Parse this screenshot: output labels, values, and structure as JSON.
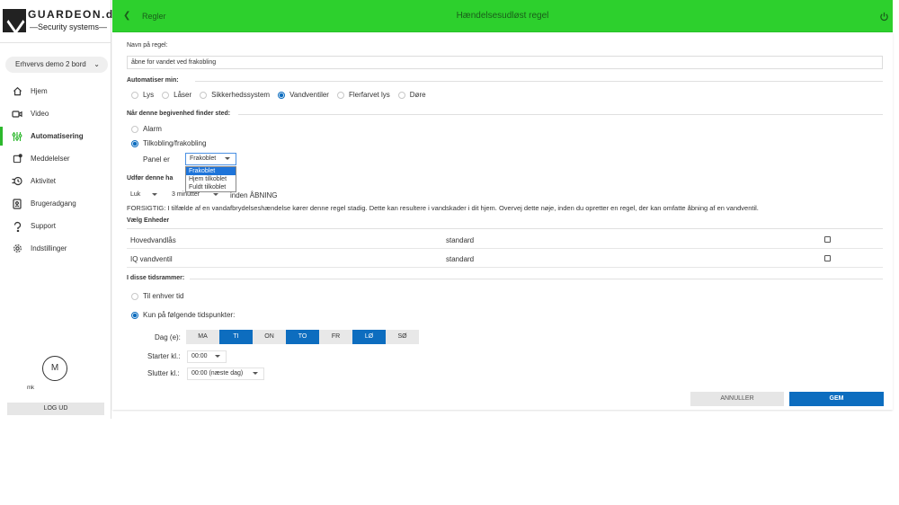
{
  "app": {
    "brand": "GUARDEON.dk",
    "tagline": "—Security systems—"
  },
  "sidebar": {
    "account": "Erhvervs demo 2 bord",
    "items": [
      {
        "label": "Hjem",
        "icon": "home-icon"
      },
      {
        "label": "Video",
        "icon": "video-icon"
      },
      {
        "label": "Automatisering",
        "icon": "automation-icon"
      },
      {
        "label": "Meddelelser",
        "icon": "notifications-icon"
      },
      {
        "label": "Aktivitet",
        "icon": "activity-icon"
      },
      {
        "label": "Brugeradgang",
        "icon": "user-access-icon"
      },
      {
        "label": "Support",
        "icon": "support-icon"
      },
      {
        "label": "Indstillinger",
        "icon": "settings-icon"
      }
    ],
    "active_item": "Automatisering",
    "avatar_initial": "M",
    "user_name": "mk",
    "logout_label": "LOG UD"
  },
  "header": {
    "back_label": "Regler",
    "title": "Hændelsesudløst regel"
  },
  "form": {
    "name_label": "Navn på regel:",
    "name_value": "åbne for vandet ved frakobling",
    "automate_label": "Automatiser min:",
    "automate_options": [
      "Lys",
      "Låser",
      "Sikkerhedssystem",
      "Vandventiler",
      "Flerfarvet lys",
      "Døre"
    ],
    "automate_selected": "Vandventiler",
    "event_label": "Når denne begivenhed finder sted:",
    "event_options": [
      "Alarm",
      "Tilkobling/frakobling"
    ],
    "event_selected": "Tilkobling/frakobling",
    "panel_label": "Panel er",
    "panel_value": "Frakoblet",
    "panel_options": [
      "Frakoblet",
      "Hjem tilkoblet",
      "Fuldt tilkoblet"
    ],
    "action_label": "Udfør denne ha",
    "action_value": "Luk",
    "delay_value": "3 minutter",
    "delay_suffix": "inden ÅBNING",
    "warning": "FORSIGTIG: I tilfælde af en vandafbrydelseshændelse kører denne regel stadig. Dette kan resultere i vandskader i dit hjem. Overvej dette nøje, inden du opretter en regel, der kan omfatte åbning af en vandventil.",
    "devices_label": "Vælg Enheder",
    "devices": [
      {
        "name": "Hovedvandlås",
        "value": "standard",
        "checked": false
      },
      {
        "name": "IQ vandventil",
        "value": "standard",
        "checked": false
      }
    ],
    "time_label": "I disse tidsrammer:",
    "time_options": [
      "Til enhver tid",
      "Kun på følgende tidspunkter:"
    ],
    "time_selected": "Kun på følgende tidspunkter:",
    "days_label": "Dag (e):",
    "days": [
      {
        "label": "MA",
        "on": false
      },
      {
        "label": "TI",
        "on": true
      },
      {
        "label": "ON",
        "on": false
      },
      {
        "label": "TO",
        "on": true
      },
      {
        "label": "FR",
        "on": false
      },
      {
        "label": "LØ",
        "on": true
      },
      {
        "label": "SØ",
        "on": false
      }
    ],
    "start_label": "Starter kl.:",
    "start_value": "00:00",
    "end_label": "Slutter kl.:",
    "end_value": "00:00 (næste dag)",
    "cancel_label": "ANNULLER",
    "save_label": "GEM"
  },
  "colors": {
    "header_green": "#2dd02d",
    "accent_blue": "#0d6dbf",
    "active_nav_green": "#2db82d"
  }
}
